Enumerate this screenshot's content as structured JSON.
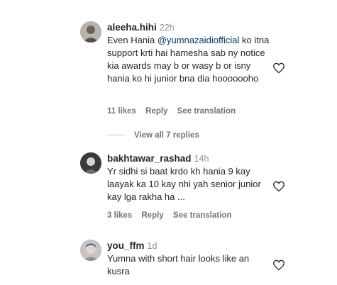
{
  "comments": [
    {
      "username": "aleeha.hihi",
      "time": "22h",
      "text_before": "Even Hania ",
      "mention": "@yumnazaidiofficial",
      "text_after": " ko itna support krti hai hamesha sab ny notice kia awards may b or wasy b or isny hania ko hi junior bna dia hooooooho",
      "likes": "11 likes",
      "reply": "Reply",
      "see_translation": "See translation",
      "view_replies": "View all 7 replies"
    },
    {
      "username": "bakhtawar_rashad",
      "time": "14h",
      "text": "Yr sidhi si baat krdo kh hania 9 kay laayak ka 10 kay nhi yah senior junior kay lga rakha ha ...",
      "likes": "3 likes",
      "reply": "Reply",
      "see_translation": "See translation"
    },
    {
      "username": "you_ffm",
      "time": "1d",
      "text": "Yumna with short hair looks like an kusra"
    }
  ],
  "icons": {
    "like": "heart-outline-icon"
  },
  "colors": {
    "mention": "#00376b",
    "secondary_text": "#737373"
  }
}
